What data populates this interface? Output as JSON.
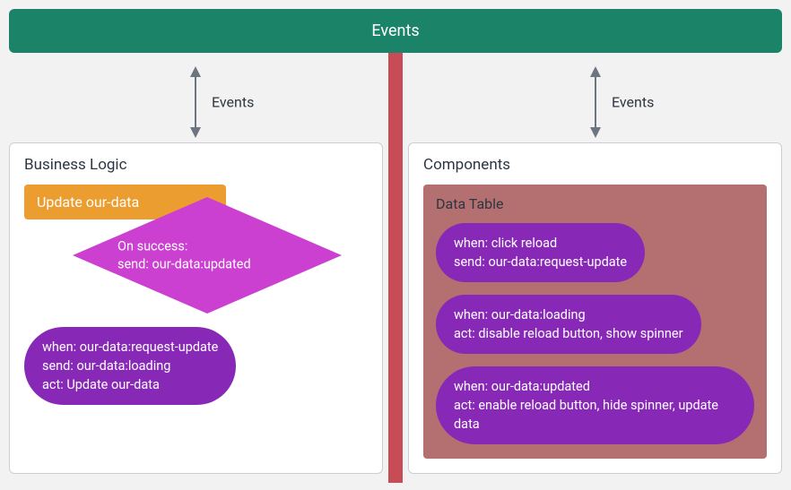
{
  "header": {
    "title": "Events"
  },
  "arrows": {
    "left_label": "Events",
    "right_label": "Events"
  },
  "colors": {
    "header_bg": "#1b8367",
    "divider": "#c84c55",
    "orange": "#ec9d2f",
    "magenta": "#cb3fd1",
    "purple": "#8828b7",
    "mauve": "#b47070"
  },
  "business": {
    "title": "Business Logic",
    "update_label": "Update our-data",
    "diamond": {
      "line1": "On success:",
      "line2": "send: our-data:updated"
    },
    "handler": {
      "line1": "when: our-data:request-update",
      "line2": "send: our-data:loading",
      "line3": "act: Update our-data"
    }
  },
  "components": {
    "title": "Components",
    "data_table": {
      "title": "Data Table",
      "h1": {
        "line1": "when: click reload",
        "line2": "send: our-data:request-update"
      },
      "h2": {
        "line1": "when: our-data:loading",
        "line2": "act: disable reload button, show spinner"
      },
      "h3": {
        "line1": "when: our-data:updated",
        "line2": "act: enable reload button, hide spinner, update data"
      }
    }
  }
}
